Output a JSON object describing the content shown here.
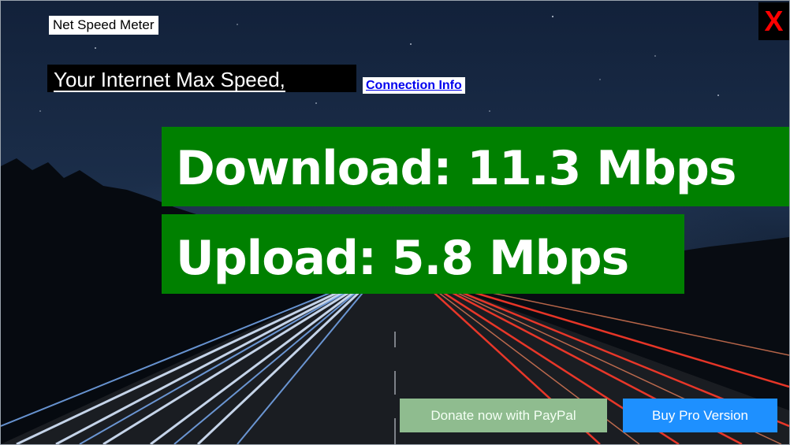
{
  "app": {
    "title": "Net Speed Meter",
    "close_label": "X"
  },
  "header": {
    "max_speed_label": "Your Internet Max Speed,",
    "connection_info_link": "Connection Info"
  },
  "speeds": {
    "download_text": "Download: 11.3 Mbps",
    "upload_text": "Upload: 5.8 Mbps",
    "download_value": 11.3,
    "upload_value": 5.8,
    "unit": "Mbps"
  },
  "buttons": {
    "donate_label": "Donate now with PayPal",
    "pro_label": "Buy Pro Version"
  },
  "colors": {
    "speed_box": "#008000",
    "close_text": "#ff0000",
    "donate_button": "#8fbc8f",
    "pro_button": "#1e90ff",
    "link": "#0000ee"
  },
  "background": {
    "description_icon": "night-highway-light-trails-image"
  }
}
